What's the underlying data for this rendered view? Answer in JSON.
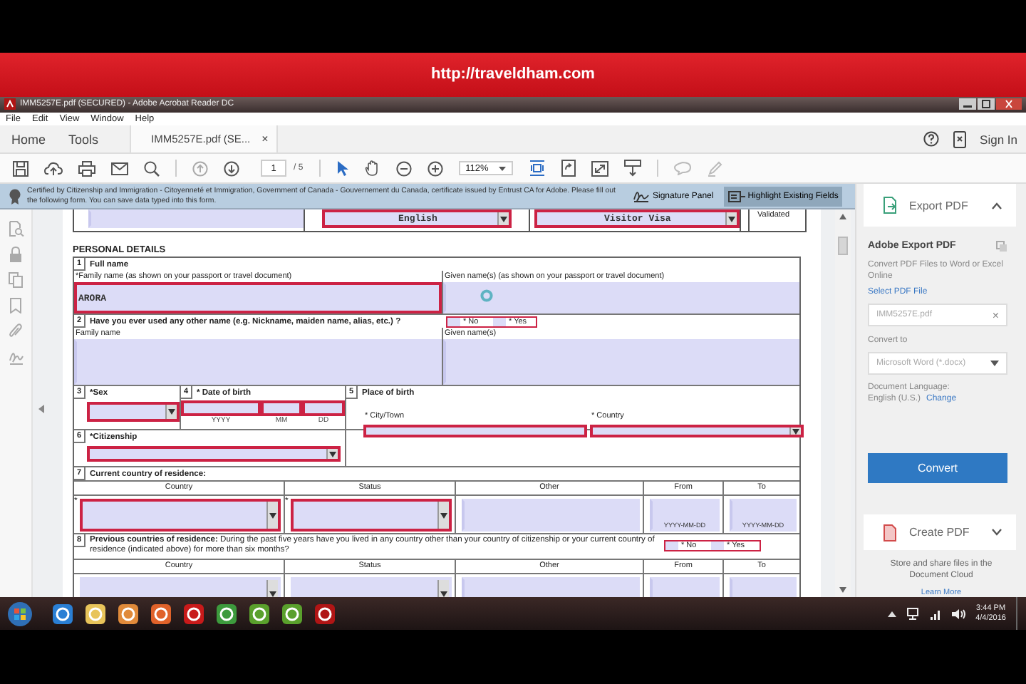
{
  "banner": {
    "url": "http://traveldham.com"
  },
  "window": {
    "title": "IMM5257E.pdf (SECURED) - Adobe Acrobat Reader DC"
  },
  "menu": [
    "File",
    "Edit",
    "View",
    "Window",
    "Help"
  ],
  "tabs": [
    {
      "label": "Home",
      "selected": false
    },
    {
      "label": "Tools",
      "selected": false
    },
    {
      "label": "IMM5257E.pdf (SE...",
      "selected": true,
      "close": "×"
    }
  ],
  "sign_in": "Sign In",
  "toolbar": {
    "page": "1",
    "page_total": "/ 5",
    "zoom": "112%"
  },
  "cert_bar": {
    "text": "Certified by Citizenship and Immigration - Citoyenneté et Immigration, Government of Canada - Gouvernement du Canada, certificate issued by Entrust CA for Adobe.  Please fill out the following form. You can save data typed into this form.",
    "buttons": [
      {
        "label": "Signature Panel",
        "pressed": false
      },
      {
        "label": "Highlight Existing Fields",
        "pressed": true
      }
    ]
  },
  "form": {
    "top_fields": [
      {
        "kind": "text",
        "required": false
      },
      {
        "kind": "dropdown",
        "required": true,
        "value": "English"
      },
      {
        "kind": "dropdown",
        "required": true,
        "value": "Visitor Visa"
      }
    ],
    "validated": "Validated",
    "section_title": "PERSONAL DETAILS",
    "q1": {
      "number": "1",
      "title": "Full name",
      "family_label": "*Family name  (as shown on your passport or travel document)",
      "family": {
        "kind": "text",
        "required": true,
        "value": "ARORA"
      },
      "given_label": "Given name(s)  (as shown on your passport or travel document)",
      "given": {
        "kind": "text",
        "required": false
      }
    },
    "q2": {
      "number": "2",
      "question": "Have you ever used any other name (e.g. Nickname, maiden name, alias, etc.) ?",
      "required": true,
      "options": [
        {
          "label": "* No",
          "selected": false
        },
        {
          "label": "* Yes",
          "selected": false
        }
      ],
      "family_label": "Family name",
      "family": {
        "kind": "text",
        "required": false
      },
      "given_label": "Given name(s)",
      "given": {
        "kind": "text",
        "required": false
      }
    },
    "q3": {
      "number": "3",
      "label": "*Sex",
      "field": {
        "kind": "dropdown",
        "required": true
      }
    },
    "q4": {
      "number": "4",
      "label": "* Date of birth",
      "fields": [
        {
          "kind": "text",
          "required": true
        },
        {
          "kind": "text",
          "required": true
        },
        {
          "kind": "text",
          "required": true
        }
      ],
      "hints": [
        "YYYY",
        "MM",
        "DD"
      ]
    },
    "q5": {
      "number": "5",
      "label": "Place of birth",
      "city_label": "* City/Town",
      "city": {
        "kind": "text",
        "required": true
      },
      "country_label": "* Country",
      "country": {
        "kind": "dropdown",
        "required": true
      }
    },
    "q6": {
      "number": "6",
      "label": "*Citizenship",
      "field": {
        "kind": "dropdown",
        "required": true
      }
    },
    "q7": {
      "number": "7",
      "label": "Current country of residence:",
      "columns": [
        "Country",
        "Status",
        "Other",
        "From",
        "To"
      ],
      "fields": [
        {
          "kind": "dropdown",
          "required": true,
          "mark": "*"
        },
        {
          "kind": "dropdown",
          "required": true,
          "mark": "*"
        },
        {
          "kind": "text",
          "required": false
        },
        {
          "kind": "text",
          "required": false,
          "format": "YYYY-MM-DD"
        },
        {
          "kind": "text",
          "required": false,
          "format": "YYYY-MM-DD"
        }
      ]
    },
    "q8": {
      "number": "8",
      "text": "**Previous countries of residence:** During the past five years have you lived in any country other than your country of citizenship or your current country of residence (indicated above) for more than six months?",
      "required": true,
      "options": [
        {
          "label": "* No",
          "selected": false
        },
        {
          "label": "* Yes",
          "selected": false
        }
      ],
      "columns": [
        "Country",
        "Status",
        "Other",
        "From",
        "To"
      ],
      "fields": [
        {
          "kind": "dropdown",
          "required": false
        },
        {
          "kind": "dropdown",
          "required": false
        },
        {
          "kind": "text",
          "required": false
        },
        {
          "kind": "text",
          "required": false
        },
        {
          "kind": "text",
          "required": false
        }
      ]
    }
  },
  "panel": {
    "header": "Export PDF",
    "title": "Adobe Export PDF",
    "description": "Convert PDF Files to Word or Excel Online",
    "select_link": "Select PDF File",
    "file": "IMM5257E.pdf",
    "clear": "×",
    "convert_label": "Convert to",
    "convert_option": "Microsoft Word (*.docx)",
    "language_label": "Document Language:",
    "language": "English (U.S.)",
    "change": "Change",
    "convert_button": "Convert",
    "create_header": "Create PDF",
    "cloud_text": "Store and share files in the Document Cloud",
    "learn_more": "Learn More"
  },
  "taskbar": {
    "time": "3:44 PM",
    "date": "4/4/2016"
  }
}
